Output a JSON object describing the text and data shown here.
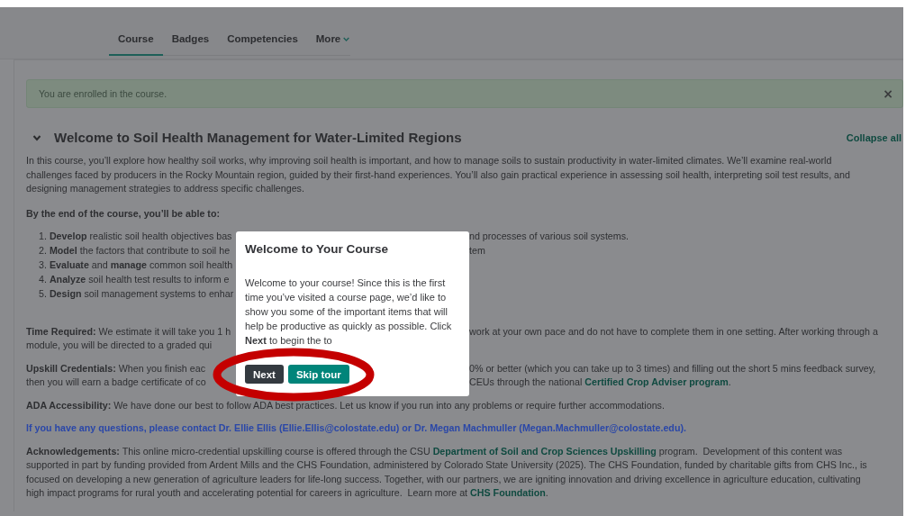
{
  "tabs": [
    {
      "label": "Course",
      "selected": true,
      "menu": false
    },
    {
      "label": "Badges",
      "selected": false,
      "menu": false
    },
    {
      "label": "Competencies",
      "selected": false,
      "menu": false
    },
    {
      "label": "More",
      "selected": false,
      "menu": true
    }
  ],
  "alert": {
    "text": "You are enrolled in the course.",
    "close": "×"
  },
  "section": {
    "title": "Welcome to Soil Health Management for Water-Limited Regions",
    "expanded": true,
    "collapse_all": "Collapse all"
  },
  "blocks": [
    {
      "kind": "paragraph",
      "lines": [
        {
          "left": [
            {
              "kind": "text",
              "text": "In this course, you’ll explore how healthy soil works, why improving soil health is important, and how to manage soils to sustain productivity in water-limited climates. We’ll examine real-world"
            }
          ]
        },
        {
          "left": [
            {
              "kind": "text",
              "text": "challenges faced by producers in the Rocky Mountain region, guided by their first-hand experiences. You’ll also gain practical experience in assessing soil health, interpreting soil test results, and"
            }
          ]
        },
        {
          "left": [
            {
              "kind": "text",
              "text": "designing management strategies to address specific challenges."
            }
          ]
        }
      ]
    },
    {
      "kind": "heading",
      "lines": [
        {
          "left": [
            {
              "kind": "text",
              "text": "By the end of the course, you’ll be able to:"
            }
          ]
        }
      ]
    },
    {
      "kind": "list",
      "lines": [
        {
          "left": [
            {
              "kind": "text",
              "text": "1. **Develop** realistic soil health objectives bas"
            }
          ],
          "right": [
            {
              "kind": "text",
              "text": "nd processes of various soil systems."
            }
          ]
        },
        {
          "left": [
            {
              "kind": "text",
              "text": "2. **Model** the factors that contribute to soil he"
            }
          ],
          "right": [
            {
              "kind": "text",
              "text": "tem"
            }
          ]
        },
        {
          "left": [
            {
              "kind": "text",
              "text": "3. **Evaluate** and **manage** common soil health"
            }
          ]
        },
        {
          "left": [
            {
              "kind": "text",
              "text": "4. **Analyze** soil health test results to inform e"
            }
          ]
        },
        {
          "left": [
            {
              "kind": "text",
              "text": "5. **Design** soil management systems to enhar"
            }
          ]
        }
      ]
    },
    {
      "kind": "paragraph",
      "lines": [
        {
          "left": [
            {
              "kind": "text",
              "text": "**Time Required:** We estimate it will take you 1 h"
            }
          ],
          "right": [
            {
              "kind": "text",
              "text": "work at your own pace and do not have to complete them in one setting. After working through a"
            }
          ]
        },
        {
          "left": [
            {
              "kind": "text",
              "text": "module, you will be directed to a graded qui"
            }
          ]
        }
      ]
    },
    {
      "kind": "paragraph",
      "lines": [
        {
          "left": [
            {
              "kind": "text",
              "text": "**Upskill Credentials:** When you finish eac"
            }
          ],
          "right": [
            {
              "kind": "text",
              "text": "0% or better (which you can take up to 3 times) and filling out the short 5 mins feedback survey,"
            }
          ]
        },
        {
          "left": [
            {
              "kind": "text",
              "text": "then you will earn a badge certificate of co"
            }
          ],
          "right": [
            {
              "kind": "text",
              "text": "CEUs through the national "
            },
            {
              "kind": "link",
              "text": "Certified Crop Adviser program"
            },
            {
              "kind": "text",
              "text": "."
            }
          ]
        }
      ]
    },
    {
      "kind": "paragraph",
      "lines": [
        {
          "left": [
            {
              "kind": "text",
              "text": "**ADA Accessibility:** We have done our best to follow ADA best practices. Let us know if you run into any problems or require further accommodations."
            }
          ]
        }
      ]
    },
    {
      "kind": "contact",
      "lines": [
        {
          "left": [
            {
              "kind": "text",
              "text": "If you have any questions, please contact Dr. Ellie Ellis (Ellie.Ellis@colostate.edu) or Dr. Megan Machmuller (Megan.Machmuller@colostate.edu)."
            }
          ]
        }
      ]
    },
    {
      "kind": "paragraph",
      "lines": [
        {
          "left": [
            {
              "kind": "text",
              "text": "**Acknowledgements:** This online micro-credential upskilling course is offered through the CSU "
            },
            {
              "kind": "link",
              "text": "Department of Soil and Crop Sciences Upskilling"
            },
            {
              "kind": "text",
              "text": " program.  Development of this content was"
            }
          ]
        },
        {
          "left": [
            {
              "kind": "text",
              "text": "supported in part by funding provided from Ardent Mills and the CHS Foundation, administered by Colorado State University (2025). The CHS Foundation, funded by charitable gifts from CHS Inc., is"
            }
          ]
        },
        {
          "left": [
            {
              "kind": "text",
              "text": "focused on developing a new generation of agriculture leaders for life-long success. Together, with our partners, we are igniting innovation and driving excellence in agriculture education, cultivating"
            }
          ]
        },
        {
          "left": [
            {
              "kind": "text",
              "text": "high impact programs for rural youth and accelerating potential for careers in agriculture.  Learn more at "
            },
            {
              "kind": "link",
              "text": "CHS Foundation"
            },
            {
              "kind": "text",
              "text": "."
            }
          ]
        }
      ]
    }
  ],
  "dialog": {
    "title": "Welcome to Your Course",
    "body": "Welcome to your course! Since this is the first time you’ve visited a course page, we’d like to show you some of the important items that will help be productive as quickly as possible. Click **Next** to begin the to",
    "buttons": [
      {
        "kind": "primary",
        "label": "Next"
      },
      {
        "kind": "secondary",
        "label": "Skip tour"
      }
    ],
    "highlighted": true
  }
}
